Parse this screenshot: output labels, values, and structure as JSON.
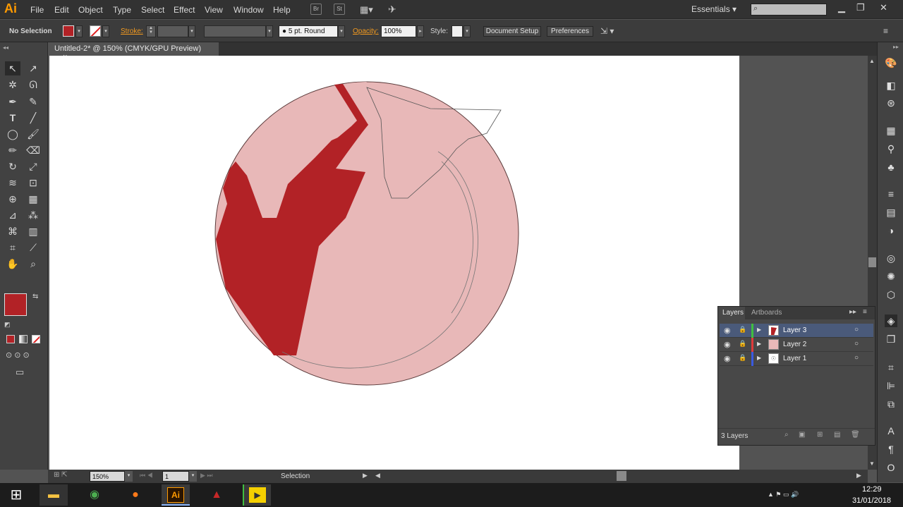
{
  "app": {
    "logo": "Ai"
  },
  "menu": [
    "File",
    "Edit",
    "Object",
    "Type",
    "Select",
    "Effect",
    "View",
    "Window",
    "Help"
  ],
  "menubar_boxes": {
    "bridge": "Br",
    "stock": "St"
  },
  "workspace": "Essentials",
  "control": {
    "selection": "No Selection",
    "stroke_label": "Stroke:",
    "brush": "5 pt. Round",
    "opacity_label": "Opacity:",
    "opacity_value": "100%",
    "style_label": "Style:",
    "document_setup": "Document Setup",
    "preferences": "Preferences"
  },
  "document_tab": {
    "title": "Untitled-2* @ 150% (CMYK/GPU Preview)",
    "close": "×"
  },
  "colors": {
    "fill": "#b22226",
    "circle_fill": "#e8b8b8",
    "layer_selected": "#4a5a7a",
    "accent": "#f39a1f"
  },
  "status": {
    "zoom": "150%",
    "artboard": "1",
    "tool": "Selection"
  },
  "layers_panel": {
    "tabs": [
      "Layers",
      "Artboards"
    ],
    "layers": [
      {
        "name": "Layer 3",
        "color": "#3fbf3f",
        "selected": true
      },
      {
        "name": "Layer 2",
        "color": "#e03a3a",
        "selected": false
      },
      {
        "name": "Layer 1",
        "color": "#3a5ae0",
        "selected": false
      }
    ],
    "count": "3 Layers"
  },
  "taskbar": {
    "time": "12:29",
    "date": "31/01/2018"
  }
}
